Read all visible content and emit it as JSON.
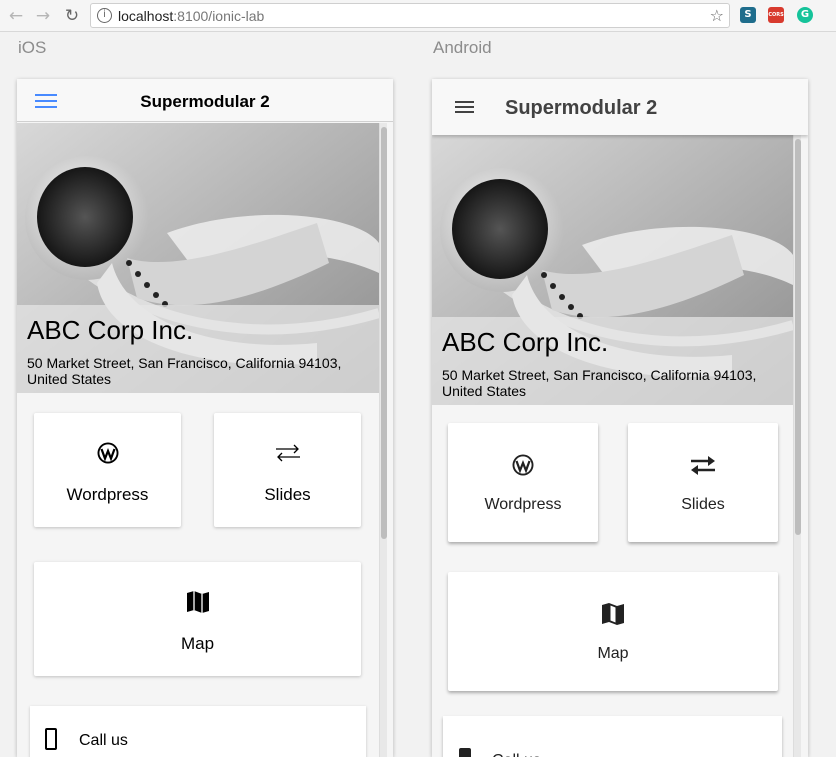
{
  "browser": {
    "url_host": "localhost",
    "url_port_path": ":8100/ionic-lab",
    "extensions": [
      "S",
      "CORS",
      "G"
    ]
  },
  "platforms": {
    "ios_label": "iOS",
    "android_label": "Android"
  },
  "app": {
    "title": "Supermodular 2",
    "company": "ABC Corp Inc.",
    "address": "50 Market Street, San Francisco, California 94103, United States",
    "cards": [
      {
        "label": "Wordpress",
        "icon": "wordpress-icon"
      },
      {
        "label": "Slides",
        "icon": "swap-arrows-icon"
      },
      {
        "label": "Map",
        "icon": "map-icon"
      }
    ],
    "call_label": "Call us"
  },
  "colors": {
    "ios_accent": "#488aff",
    "android_toolbar_text": "#424242"
  }
}
